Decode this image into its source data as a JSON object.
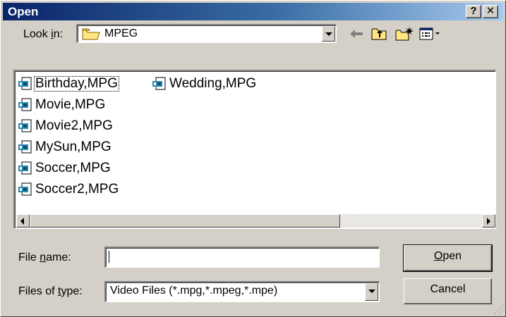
{
  "window": {
    "title": "Open"
  },
  "caption_buttons": {
    "help": "?",
    "close": "✕"
  },
  "look_in": {
    "label_pre": "Look ",
    "label_u": "i",
    "label_post": "n:",
    "value": "MPEG",
    "value_icon": "folder-icon"
  },
  "toolbar": {
    "icons": [
      "back-arrow-icon",
      "up-one-level-icon",
      "new-folder-icon",
      "view-menu-icon"
    ]
  },
  "files": [
    {
      "name": "Birthday,MPG",
      "icon": "video-file-icon"
    },
    {
      "name": "Movie,MPG",
      "icon": "video-file-icon"
    },
    {
      "name": "Movie2,MPG",
      "icon": "video-file-icon"
    },
    {
      "name": "MySun,MPG",
      "icon": "video-file-icon"
    },
    {
      "name": "Soccer,MPG",
      "icon": "video-file-icon"
    },
    {
      "name": "Soccer2,MPG",
      "icon": "video-file-icon"
    },
    {
      "name": "Wedding,MPG",
      "icon": "video-file-icon"
    }
  ],
  "file_name": {
    "label_pre": "File ",
    "label_u": "n",
    "label_post": "ame:",
    "value": ""
  },
  "file_type": {
    "label_pre": "Files of ",
    "label_u": "t",
    "label_post": "ype:",
    "value": "Video Files (*.mpg,*.mpeg,*.mpe)"
  },
  "buttons": {
    "open_u": "O",
    "open_rest": "pen",
    "cancel": "Cancel"
  },
  "colors": {
    "titlebar_start": "#0a246a",
    "titlebar_end": "#a6caf0",
    "face": "#d4d0c8"
  }
}
